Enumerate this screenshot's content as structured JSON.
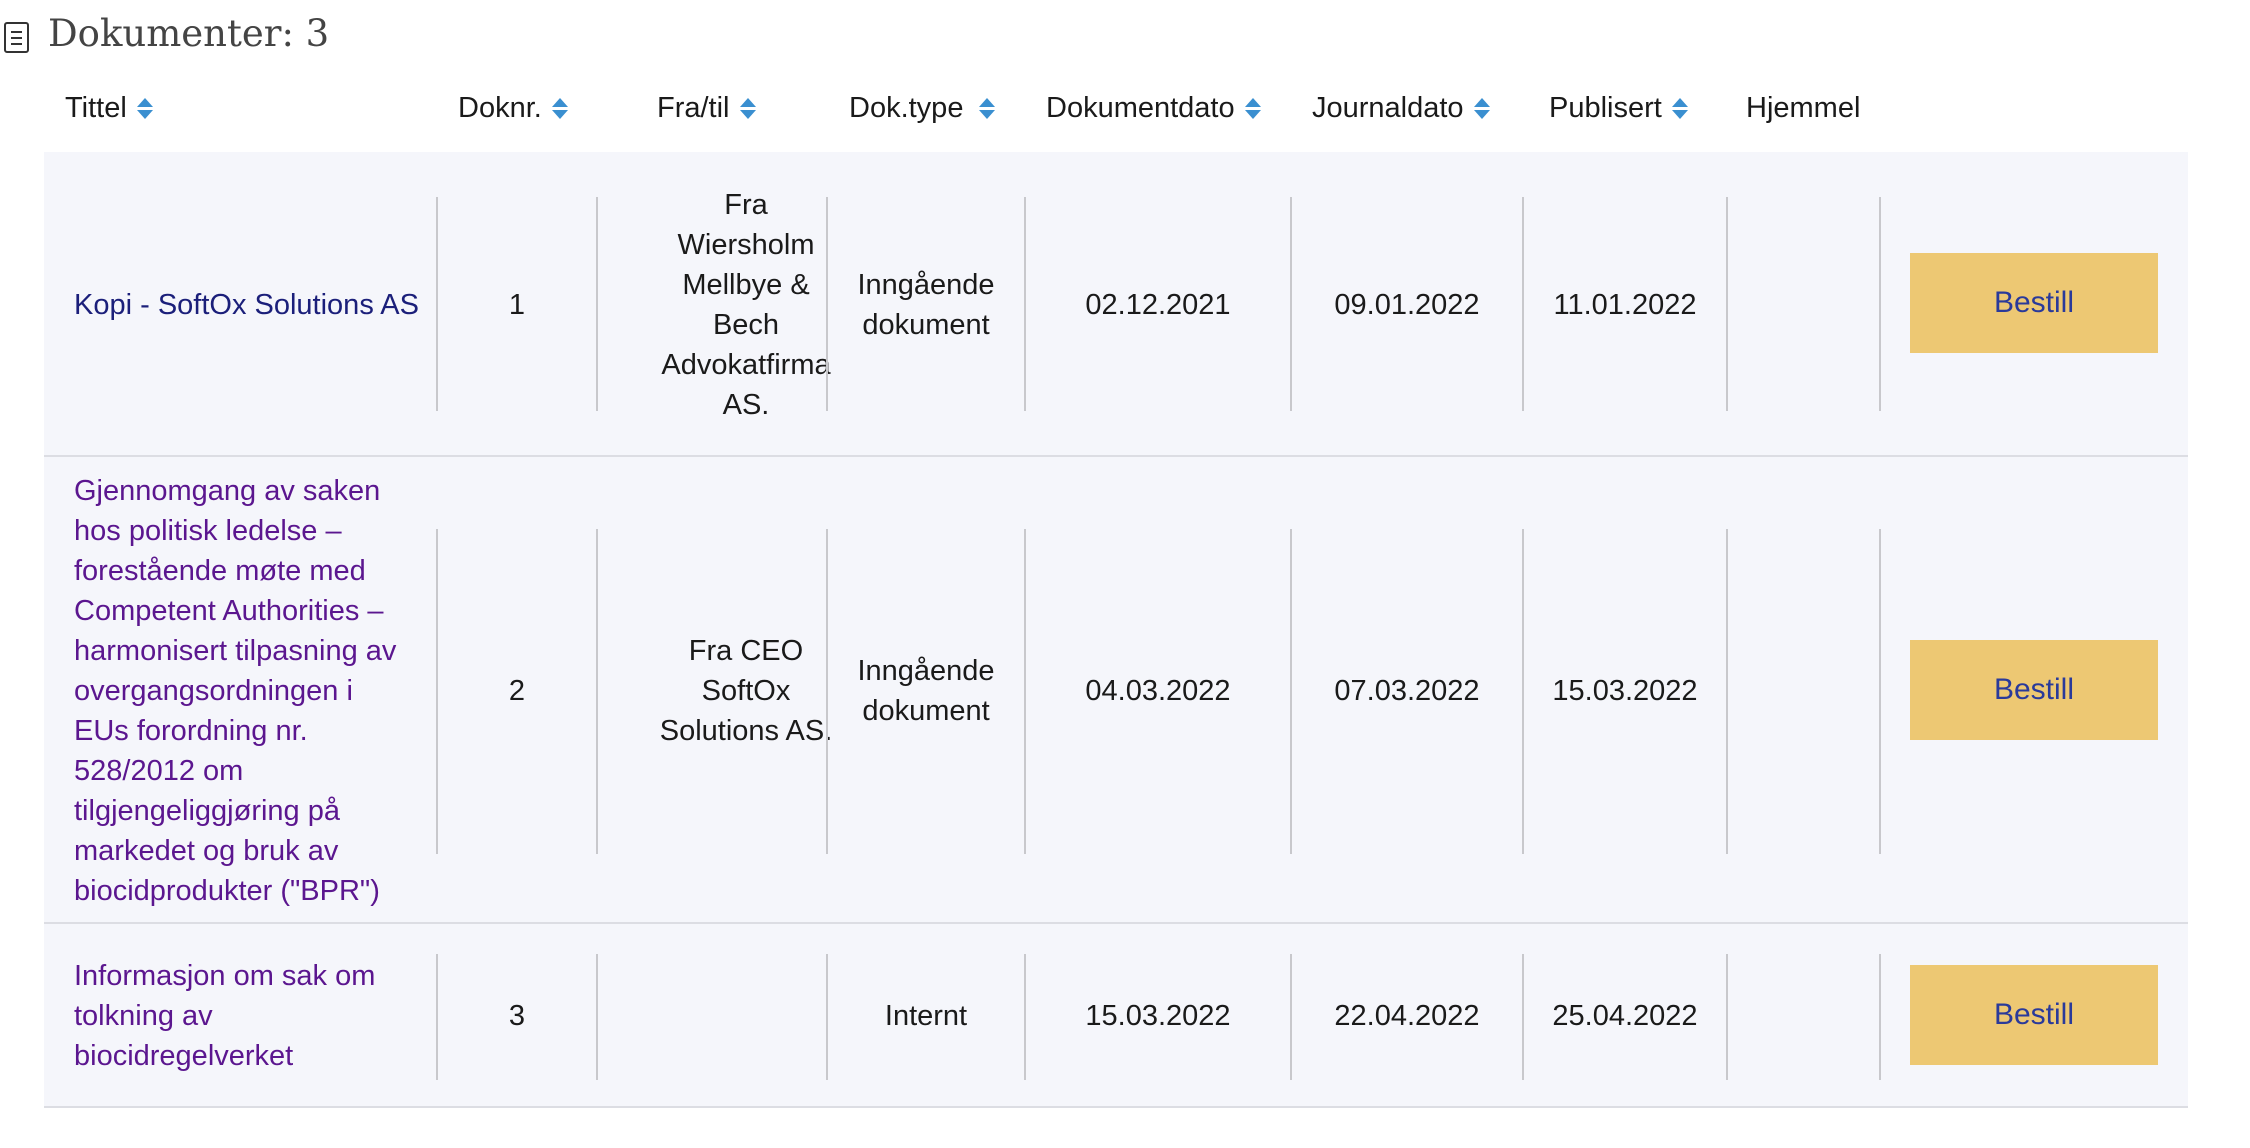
{
  "header": {
    "icon": "document-icon",
    "title": "Dokumenter: 3"
  },
  "columns": {
    "tittel": "Tittel",
    "doknr": "Doknr.",
    "fra_til": "Fra/til",
    "doktype": "Dok.type",
    "dokumentdato": "Dokumentdato",
    "journaldato": "Journaldato",
    "publisert": "Publisert",
    "hjemmel": "Hjemmel"
  },
  "colors": {
    "link": "#1b1f7a",
    "visited_link": "#5b168f",
    "button": "#edc873",
    "sort_icon": "#3a8fd0",
    "row_bg": "#f5f6fb"
  },
  "rows": [
    {
      "title": "Kopi - SoftOx Solutions AS",
      "doknr": "1",
      "fra_til": "Fra Wiersholm Mellbye & Bech Advokatfirma AS.",
      "doktype": "Inngående dokument",
      "dokumentdato": "02.12.2021",
      "journaldato": "09.01.2022",
      "publisert": "11.01.2022",
      "hjemmel": "",
      "button": "Bestill"
    },
    {
      "title": "Gjennomgang av saken hos politisk ledelse – forestående møte med Competent Authorities – harmonisert tilpasning av overgangsordningen i EUs forordning nr. 528/2012 om tilgjengeliggjøring på markedet og bruk av biocidprodukter (\"BPR\")",
      "doknr": "2",
      "fra_til": "Fra CEO SoftOx Solutions AS.",
      "doktype": "Inngående dokument",
      "dokumentdato": "04.03.2022",
      "journaldato": "07.03.2022",
      "publisert": "15.03.2022",
      "hjemmel": "",
      "button": "Bestill"
    },
    {
      "title": "Informasjon om sak om tolkning av biocidregelverket",
      "doknr": "3",
      "fra_til": "",
      "doktype": "Internt",
      "dokumentdato": "15.03.2022",
      "journaldato": "22.04.2022",
      "publisert": "25.04.2022",
      "hjemmel": "",
      "button": "Bestill"
    }
  ]
}
